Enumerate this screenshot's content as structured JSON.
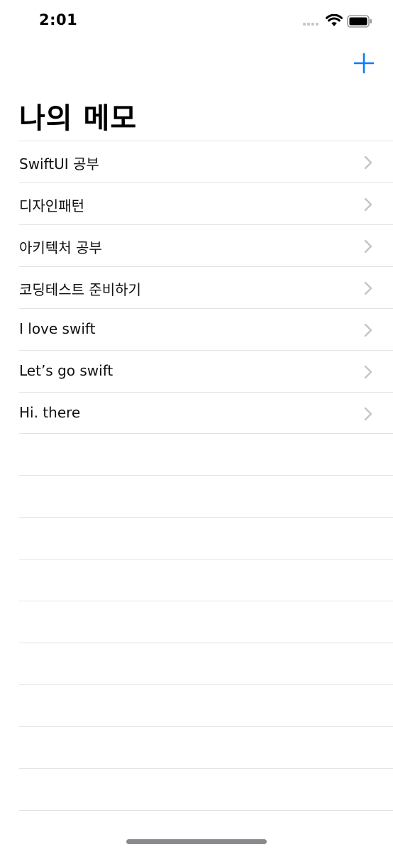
{
  "status_bar": {
    "time": "2:01"
  },
  "header": {
    "title": "나의 메모",
    "add_icon": "plus-icon"
  },
  "memos": [
    {
      "label": "SwiftUI 공부"
    },
    {
      "label": "디자인패턴"
    },
    {
      "label": "아키텍처 공부"
    },
    {
      "label": "코딩테스트 준비하기"
    },
    {
      "label": "I love swift"
    },
    {
      "label": "Let’s go swift"
    },
    {
      "label": "Hi. there"
    }
  ],
  "colors": {
    "accent": "#0a7aff",
    "separator": "#e3e3e6",
    "chevron": "#c4c4c7"
  }
}
